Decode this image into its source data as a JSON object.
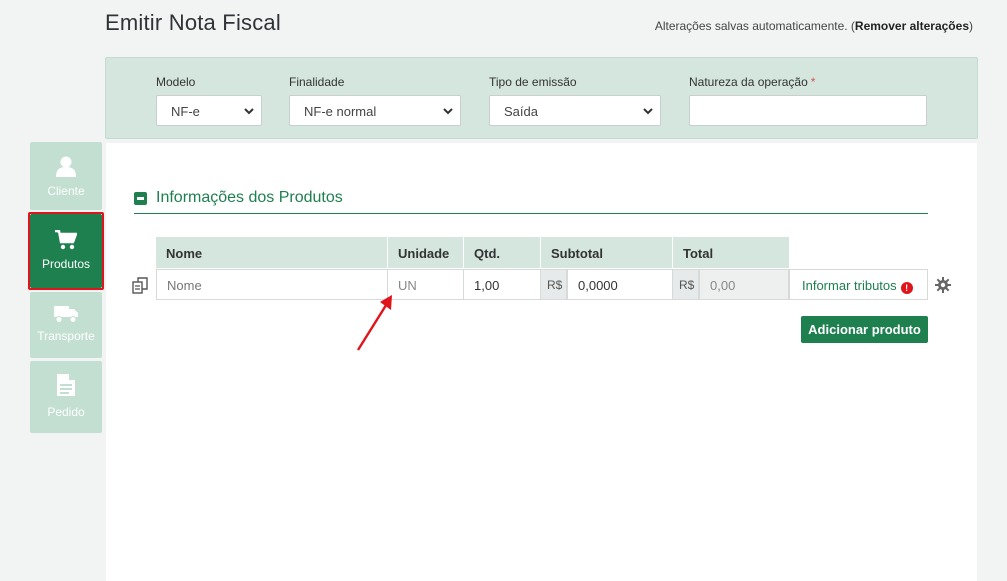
{
  "header": {
    "title": "Emitir Nota Fiscal",
    "autosave_text": "Alterações salvas automaticamente. (",
    "remove_link": "Remover alterações",
    "autosave_close": ")"
  },
  "config": {
    "modelo": {
      "label": "Modelo",
      "value": "NF-e"
    },
    "finalidade": {
      "label": "Finalidade",
      "value": "NF-e normal"
    },
    "tipo_emissao": {
      "label": "Tipo de emissão",
      "value": "Saída"
    },
    "natureza": {
      "label": "Natureza da operação",
      "required_mark": "*",
      "value": ""
    }
  },
  "sidebar": {
    "items": [
      {
        "label": "Cliente",
        "icon": "user-icon",
        "active": false
      },
      {
        "label": "Produtos",
        "icon": "cart-icon",
        "active": true
      },
      {
        "label": "Transporte",
        "icon": "truck-icon",
        "active": false
      },
      {
        "label": "Pedido",
        "icon": "document-icon",
        "active": false
      }
    ]
  },
  "products": {
    "section_title": "Informações dos Produtos",
    "columns": [
      "Nome",
      "Unidade",
      "Qtd.",
      "Subtotal",
      "Total"
    ],
    "row": {
      "nome_placeholder": "Nome",
      "unidade": "UN",
      "qtd": "1,00",
      "currency": "R$",
      "subtotal": "0,0000",
      "total": "0,00"
    },
    "tributos_label": "Informar tributos",
    "tributos_alert": "!",
    "add_button": "Adicionar produto"
  },
  "colors": {
    "brand_green": "#1e7f4f",
    "panel_green": "#d4e6dd",
    "inactive_tab": "#c2dfd1",
    "highlight_red": "#e0141b"
  }
}
